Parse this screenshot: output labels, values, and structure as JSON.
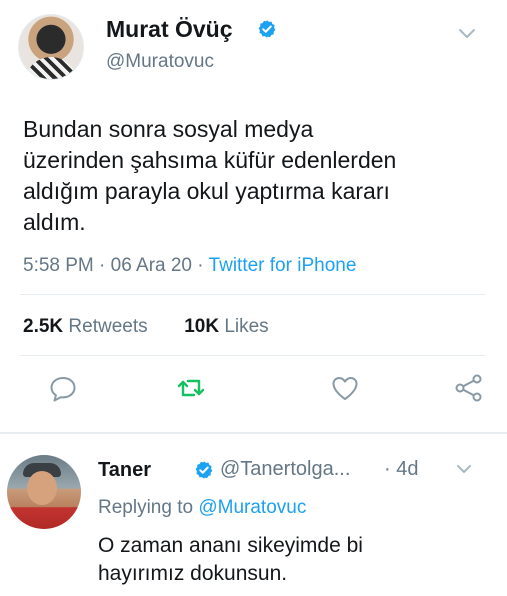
{
  "tweet": {
    "author_name": "Murat Övüç",
    "author_handle": "@Muratovuc",
    "text_lines": [
      "Bundan sonra sosyal medya",
      "üzerinden şahsıma küfür edenlerden",
      "aldığım parayla okul yaptırma kararı",
      "aldım."
    ],
    "time": "5:58 PM",
    "separator": "·",
    "date": "06 Ara 20",
    "source": "Twitter for iPhone",
    "retweets_count": "2.5K",
    "retweets_label": "Retweets",
    "likes_count": "10K",
    "likes_label": "Likes"
  },
  "reply": {
    "author_name": "Taner",
    "author_handle": "@Tanertolga...",
    "time": "· 4d",
    "replying_label": "Replying to",
    "replying_handle": "@Muratovuc",
    "text_lines": [
      "O zaman ananı sikeyimde bi",
      "hayırımız dokunsun."
    ]
  },
  "icons": {
    "verified": "verified-badge-icon",
    "more": "chevron-down-icon",
    "reply": "reply-icon",
    "retweet": "retweet-icon",
    "like": "heart-icon",
    "share": "share-icon"
  },
  "colors": {
    "accent": "#1da1f2",
    "retweet": "#17bf63",
    "secondary_text": "#657786",
    "divider": "#e6ecf0"
  }
}
